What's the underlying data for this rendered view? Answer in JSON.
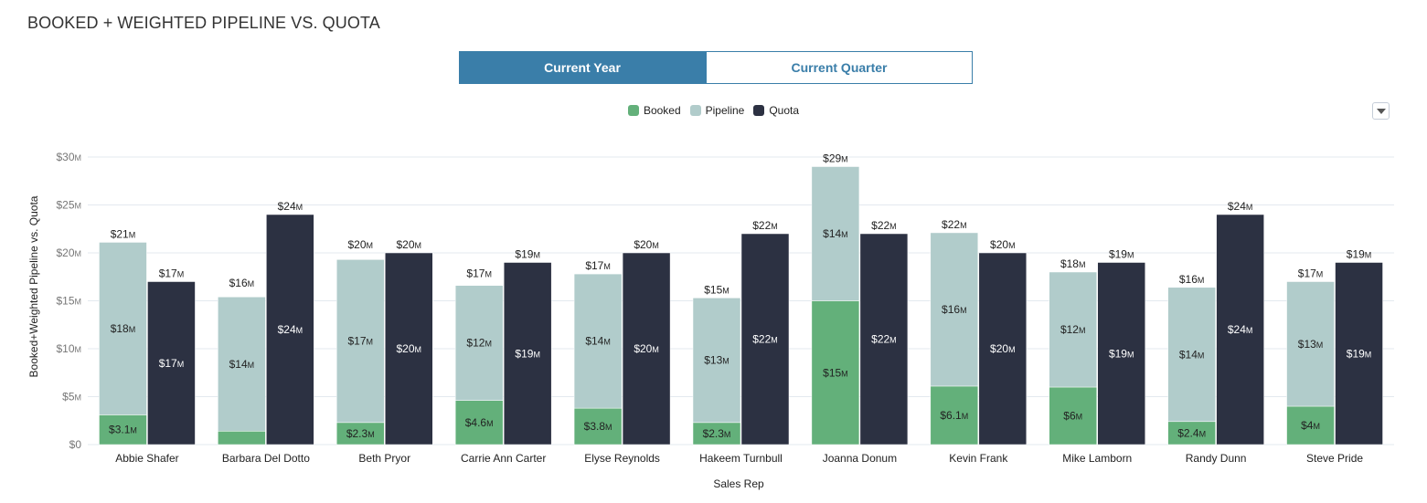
{
  "header": {
    "title": "BOOKED + WEIGHTED PIPELINE VS. QUOTA"
  },
  "toggle": {
    "options": [
      {
        "label": "Current Year",
        "active": true
      },
      {
        "label": "Current Quarter",
        "active": false
      }
    ]
  },
  "menu": {
    "icon": "dropdown-triangle-icon"
  },
  "colors": {
    "booked": "#63b07a",
    "pipeline": "#b1cccb",
    "quota": "#2c3142",
    "accent": "#3a7ea9",
    "grid": "#e3e9ef"
  },
  "chart_data": {
    "type": "bar",
    "title": "BOOKED + WEIGHTED PIPELINE VS. QUOTA",
    "xlabel": "Sales Rep",
    "ylabel": "Booked+Weighted Pipeline vs. Quota",
    "ylim": [
      0,
      30
    ],
    "yunit": "M",
    "yticks": [
      0,
      5,
      10,
      15,
      20,
      25,
      30
    ],
    "ytick_labels": [
      "$0",
      "$5M",
      "$10M",
      "$15M",
      "$20M",
      "$25M",
      "$30M"
    ],
    "grid": true,
    "legend": {
      "position": "top-center",
      "entries": [
        "Booked",
        "Pipeline",
        "Quota"
      ]
    },
    "categories": [
      "Abbie Shafer",
      "Barbara Del Dotto",
      "Beth Pryor",
      "Carrie Ann Carter",
      "Elyse Reynolds",
      "Hakeem Turnbull",
      "Joanna Donum",
      "Kevin Frank",
      "Mike Lamborn",
      "Randy Dunn",
      "Steve Pride"
    ],
    "series": [
      {
        "name": "Booked",
        "stack": "actual",
        "values": [
          3.1,
          1.4,
          2.3,
          4.6,
          3.8,
          2.3,
          15,
          6.1,
          6,
          2.4,
          4
        ],
        "labels": [
          "$3.1M",
          "",
          "$2.3M",
          "$4.6M",
          "$3.8M",
          "$2.3M",
          "$15M",
          "$6.1M",
          "$6M",
          "$2.4M",
          "$4M"
        ]
      },
      {
        "name": "Pipeline",
        "stack": "actual",
        "values": [
          18,
          14,
          17,
          12,
          14,
          13,
          14,
          16,
          12,
          14,
          13
        ],
        "labels": [
          "$18M",
          "$14M",
          "$17M",
          "$12M",
          "$14M",
          "$13M",
          "$14M",
          "$16M",
          "$12M",
          "$14M",
          "$13M"
        ]
      },
      {
        "name": "Quota",
        "stack": "quota",
        "values": [
          17,
          24,
          20,
          19,
          20,
          22,
          22,
          20,
          19,
          24,
          19
        ],
        "labels": [
          "$17M",
          "$24M",
          "$20M",
          "$19M",
          "$20M",
          "$22M",
          "$22M",
          "$20M",
          "$19M",
          "$24M",
          "$19M"
        ]
      }
    ],
    "totals": {
      "actual": {
        "values": [
          21,
          16,
          20,
          17,
          17,
          15,
          29,
          22,
          18,
          16,
          17
        ],
        "labels": [
          "$21M",
          "$16M",
          "$20M",
          "$17M",
          "$17M",
          "$15M",
          "$29M",
          "$22M",
          "$18M",
          "$16M",
          "$17M"
        ]
      },
      "quota": {
        "labels": [
          "$17M",
          "$24M",
          "$20M",
          "$19M",
          "$20M",
          "$22M",
          "$22M",
          "$20M",
          "$19M",
          "$24M",
          "$19M"
        ]
      }
    }
  }
}
